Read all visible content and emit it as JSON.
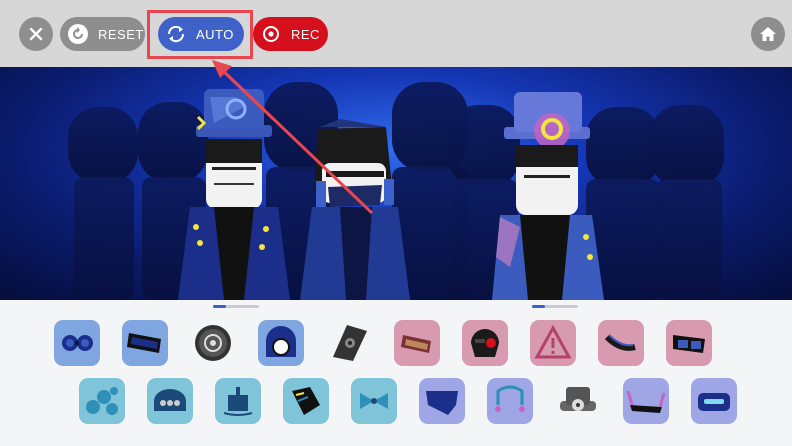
{
  "toolbar": {
    "close_icon": "close-icon",
    "reset_label": "RESET",
    "auto_label": "AUTO",
    "rec_label": "REC",
    "home_icon": "home-icon"
  },
  "colors": {
    "toolbar_bg": "#d7d7d7",
    "button_gray": "#8e8e8e",
    "auto_blue": "#3f62c8",
    "rec_red": "#d50f1c",
    "highlight_red": "#e8474f",
    "tray_beat": "#7fa6e0",
    "tray_effect": "#d79aae",
    "tray_melody": "#7fc4d8",
    "tray_voice": "#9fa6e6"
  },
  "tray": {
    "row1": [
      {
        "name": "goggles-icon",
        "category": "beat"
      },
      {
        "name": "visor-icon",
        "category": "beat"
      },
      {
        "name": "speaker-icon",
        "category": "beat"
      },
      {
        "name": "helmet-icon",
        "category": "beat"
      },
      {
        "name": "diamond-mask-icon",
        "category": "beat"
      },
      {
        "name": "glasses-box-icon",
        "category": "effect"
      },
      {
        "name": "mask-icon",
        "category": "effect"
      },
      {
        "name": "warning-icon",
        "category": "effect"
      },
      {
        "name": "headset-icon",
        "category": "effect"
      },
      {
        "name": "shades-icon",
        "category": "effect"
      }
    ],
    "row2": [
      {
        "name": "bubbles-icon",
        "category": "melody"
      },
      {
        "name": "dome-hat-icon",
        "category": "melody"
      },
      {
        "name": "camera-icon",
        "category": "melody"
      },
      {
        "name": "glove-icon",
        "category": "melody"
      },
      {
        "name": "bow-icon",
        "category": "melody"
      },
      {
        "name": "scarf-icon",
        "category": "voice"
      },
      {
        "name": "headphones-icon",
        "category": "voice"
      },
      {
        "name": "top-hat-icon",
        "category": "voice"
      },
      {
        "name": "horns-icon",
        "category": "voice"
      },
      {
        "name": "led-visor-icon",
        "category": "voice"
      }
    ]
  }
}
